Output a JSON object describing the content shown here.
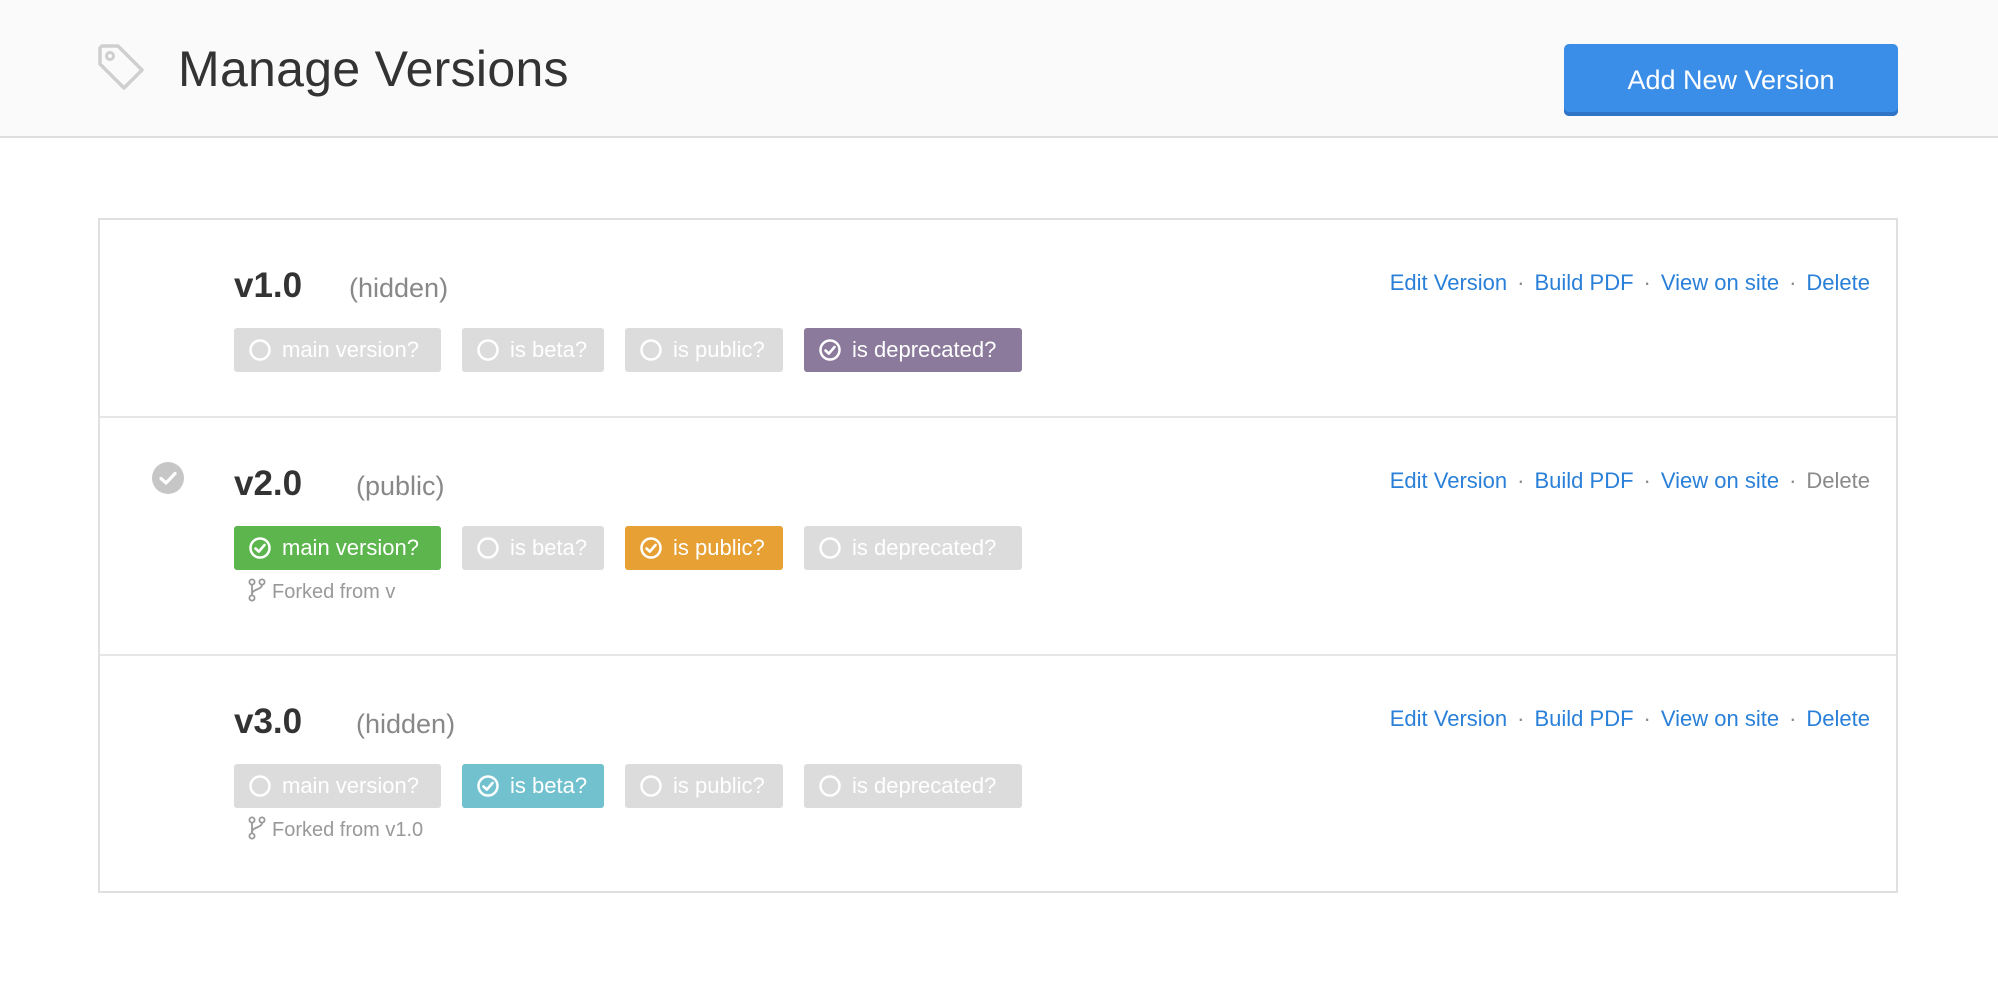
{
  "header": {
    "title": "Manage Versions",
    "add_button_label": "Add New Version",
    "icon": "tag-icon"
  },
  "colors": {
    "primary": "#3a8ee8",
    "link": "#2a80d8",
    "main_version": "#5cb54d",
    "is_beta": "#72c1cf",
    "is_public": "#e6a033",
    "is_deprecated": "#8b7a9b",
    "inactive": "#dcdcdc"
  },
  "versions": [
    {
      "name": "v1.0",
      "visibility": "(hidden)",
      "is_main": false,
      "actions": {
        "edit": "Edit Version",
        "build_pdf": "Build PDF",
        "view": "View on site",
        "delete": "Delete"
      },
      "toggles": [
        {
          "label": "main version?",
          "checked": false
        },
        {
          "label": "is beta?",
          "checked": false
        },
        {
          "label": "is public?",
          "checked": false
        },
        {
          "label": "is deprecated?",
          "checked": true
        }
      ],
      "forked_from": ""
    },
    {
      "name": "v2.0",
      "visibility": "(public)",
      "is_main": true,
      "actions": {
        "edit": "Edit Version",
        "build_pdf": "Build PDF",
        "view": "View on site",
        "delete": "Delete"
      },
      "toggles": [
        {
          "label": "main version?",
          "checked": true
        },
        {
          "label": "is beta?",
          "checked": false
        },
        {
          "label": "is public?",
          "checked": true
        },
        {
          "label": "is deprecated?",
          "checked": false
        }
      ],
      "forked_from": "Forked from v"
    },
    {
      "name": "v3.0",
      "visibility": "(hidden)",
      "is_main": false,
      "actions": {
        "edit": "Edit Version",
        "build_pdf": "Build PDF",
        "view": "View on site",
        "delete": "Delete"
      },
      "toggles": [
        {
          "label": "main version?",
          "checked": false
        },
        {
          "label": "is beta?",
          "checked": true
        },
        {
          "label": "is public?",
          "checked": false
        },
        {
          "label": "is deprecated?",
          "checked": false
        }
      ],
      "forked_from": "Forked from v1.0"
    }
  ],
  "action_separator": "·"
}
